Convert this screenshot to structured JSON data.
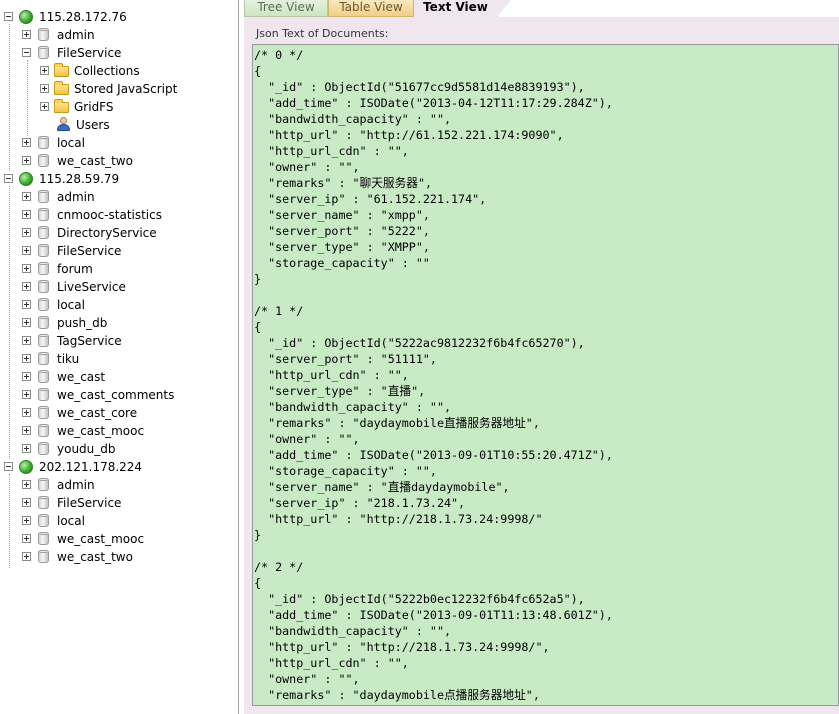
{
  "tree": [
    {
      "label": "115.28.172.76",
      "type": "server",
      "level": 0,
      "expander": "minus"
    },
    {
      "label": "admin",
      "type": "db",
      "level": 1,
      "expander": "plus"
    },
    {
      "label": "FileService",
      "type": "db",
      "level": 1,
      "expander": "minus"
    },
    {
      "label": "Collections",
      "type": "folder",
      "level": 2,
      "expander": "plus"
    },
    {
      "label": "Stored JavaScript",
      "type": "folder",
      "level": 2,
      "expander": "plus"
    },
    {
      "label": "GridFS",
      "type": "folder",
      "level": 2,
      "expander": "plus"
    },
    {
      "label": "Users",
      "type": "users",
      "level": 2,
      "expander": "none"
    },
    {
      "label": "local",
      "type": "db",
      "level": 1,
      "expander": "plus"
    },
    {
      "label": "we_cast_two",
      "type": "db",
      "level": 1,
      "expander": "plus"
    },
    {
      "label": "115.28.59.79",
      "type": "server",
      "level": 0,
      "expander": "minus"
    },
    {
      "label": "admin",
      "type": "db",
      "level": 1,
      "expander": "plus"
    },
    {
      "label": "cnmooc-statistics",
      "type": "db",
      "level": 1,
      "expander": "plus"
    },
    {
      "label": "DirectoryService",
      "type": "db",
      "level": 1,
      "expander": "plus"
    },
    {
      "label": "FileService",
      "type": "db",
      "level": 1,
      "expander": "plus"
    },
    {
      "label": "forum",
      "type": "db",
      "level": 1,
      "expander": "plus"
    },
    {
      "label": "LiveService",
      "type": "db",
      "level": 1,
      "expander": "plus"
    },
    {
      "label": "local",
      "type": "db",
      "level": 1,
      "expander": "plus"
    },
    {
      "label": "push_db",
      "type": "db",
      "level": 1,
      "expander": "plus"
    },
    {
      "label": "TagService",
      "type": "db",
      "level": 1,
      "expander": "plus"
    },
    {
      "label": "tiku",
      "type": "db",
      "level": 1,
      "expander": "plus"
    },
    {
      "label": "we_cast",
      "type": "db",
      "level": 1,
      "expander": "plus"
    },
    {
      "label": "we_cast_comments",
      "type": "db",
      "level": 1,
      "expander": "plus"
    },
    {
      "label": "we_cast_core",
      "type": "db",
      "level": 1,
      "expander": "plus"
    },
    {
      "label": "we_cast_mooc",
      "type": "db",
      "level": 1,
      "expander": "plus"
    },
    {
      "label": "youdu_db",
      "type": "db",
      "level": 1,
      "expander": "plus"
    },
    {
      "label": "202.121.178.224",
      "type": "server",
      "level": 0,
      "expander": "minus"
    },
    {
      "label": "admin",
      "type": "db",
      "level": 1,
      "expander": "plus"
    },
    {
      "label": "FileService",
      "type": "db",
      "level": 1,
      "expander": "plus"
    },
    {
      "label": "local",
      "type": "db",
      "level": 1,
      "expander": "plus"
    },
    {
      "label": "we_cast_mooc",
      "type": "db",
      "level": 1,
      "expander": "plus"
    },
    {
      "label": "we_cast_two",
      "type": "db",
      "level": 1,
      "expander": "plus"
    }
  ],
  "tabs": {
    "tree_view": "Tree View",
    "table_view": "Table View",
    "text_view": "Text View"
  },
  "json_label": "Json Text of Documents:",
  "code_lines": [
    "/* 0 */",
    "{",
    "  \"_id\" : ObjectId(\"51677cc9d5581d14e8839193\"),",
    "  \"add_time\" : ISODate(\"2013-04-12T11:17:29.284Z\"),",
    "  \"bandwidth_capacity\" : \"\",",
    "  \"http_url\" : \"http://61.152.221.174:9090\",",
    "  \"http_url_cdn\" : \"\",",
    "  \"owner\" : \"\",",
    "  \"remarks\" : \"聊天服务器\",",
    "  \"server_ip\" : \"61.152.221.174\",",
    "  \"server_name\" : \"xmpp\",",
    "  \"server_port\" : \"5222\",",
    "  \"server_type\" : \"XMPP\",",
    "  \"storage_capacity\" : \"\"",
    "}",
    "",
    "/* 1 */",
    "{",
    "  \"_id\" : ObjectId(\"5222ac9812232f6b4fc65270\"),",
    "  \"server_port\" : \"51111\",",
    "  \"http_url_cdn\" : \"\",",
    "  \"server_type\" : \"直播\",",
    "  \"bandwidth_capacity\" : \"\",",
    "  \"remarks\" : \"daydaymobile直播服务器地址\",",
    "  \"owner\" : \"\",",
    "  \"add_time\" : ISODate(\"2013-09-01T10:55:20.471Z\"),",
    "  \"storage_capacity\" : \"\",",
    "  \"server_name\" : \"直播daydaymobile\",",
    "  \"server_ip\" : \"218.1.73.24\",",
    "  \"http_url\" : \"http://218.1.73.24:9998/\"",
    "}",
    "",
    "/* 2 */",
    "{",
    "  \"_id\" : ObjectId(\"5222b0ec12232f6b4fc652a5\"),",
    "  \"add_time\" : ISODate(\"2013-09-01T11:13:48.601Z\"),",
    "  \"bandwidth_capacity\" : \"\",",
    "  \"http_url\" : \"http://218.1.73.24:9998/\",",
    "  \"http_url_cdn\" : \"\",",
    "  \"owner\" : \"\",",
    "  \"remarks\" : \"daydaymobile点播服务器地址\","
  ]
}
